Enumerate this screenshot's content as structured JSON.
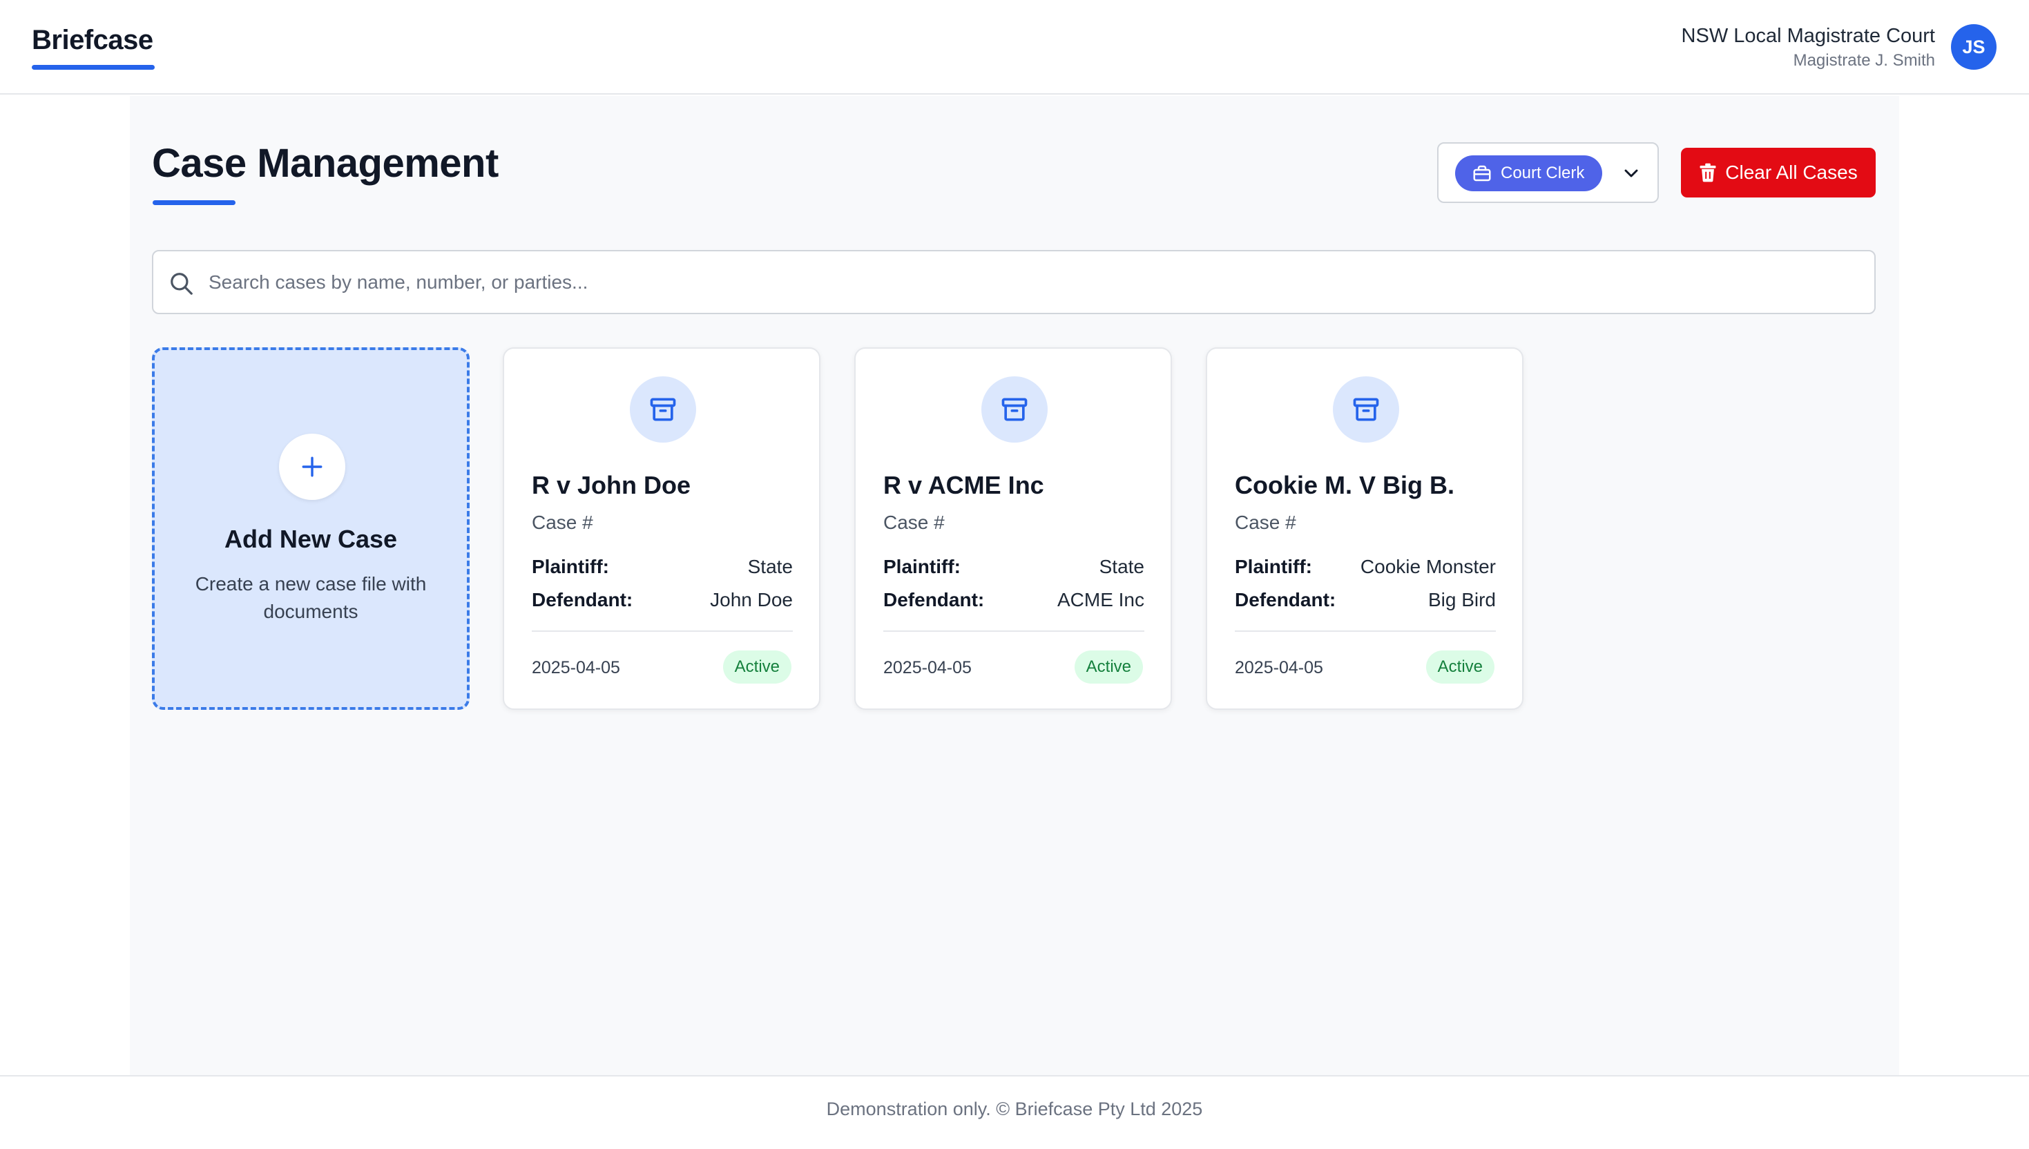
{
  "header": {
    "brand": "Briefcase",
    "court_name": "NSW Local Magistrate Court",
    "user_name": "Magistrate J. Smith",
    "avatar_initials": "JS"
  },
  "page": {
    "title": "Case Management",
    "role_selected": "Court Clerk",
    "role_icon": "briefcase-icon",
    "clear_button_label": "Clear All Cases",
    "search_placeholder": "Search cases by name, number, or parties..."
  },
  "add_case": {
    "title": "Add New Case",
    "description": "Create a new case file with documents"
  },
  "labels": {
    "plaintiff": "Plaintiff:",
    "defendant": "Defendant:"
  },
  "cases": [
    {
      "title": "R v John Doe",
      "case_number": "Case #",
      "plaintiff": "State",
      "defendant": "John Doe",
      "date": "2025-04-05",
      "status": "Active"
    },
    {
      "title": "R v ACME Inc",
      "case_number": "Case #",
      "plaintiff": "State",
      "defendant": "ACME Inc",
      "date": "2025-04-05",
      "status": "Active"
    },
    {
      "title": "Cookie M. V Big B.",
      "case_number": "Case #",
      "plaintiff": "Cookie Monster",
      "defendant": "Big Bird",
      "date": "2025-04-05",
      "status": "Active"
    }
  ],
  "footer": {
    "text": "Demonstration only. © Briefcase Pty Ltd 2025"
  },
  "colors": {
    "accent": "#2563eb",
    "danger": "#e30b14",
    "role_pill": "#4f63e8",
    "status_active_bg": "#dcfce7",
    "status_active_text": "#15803d"
  }
}
